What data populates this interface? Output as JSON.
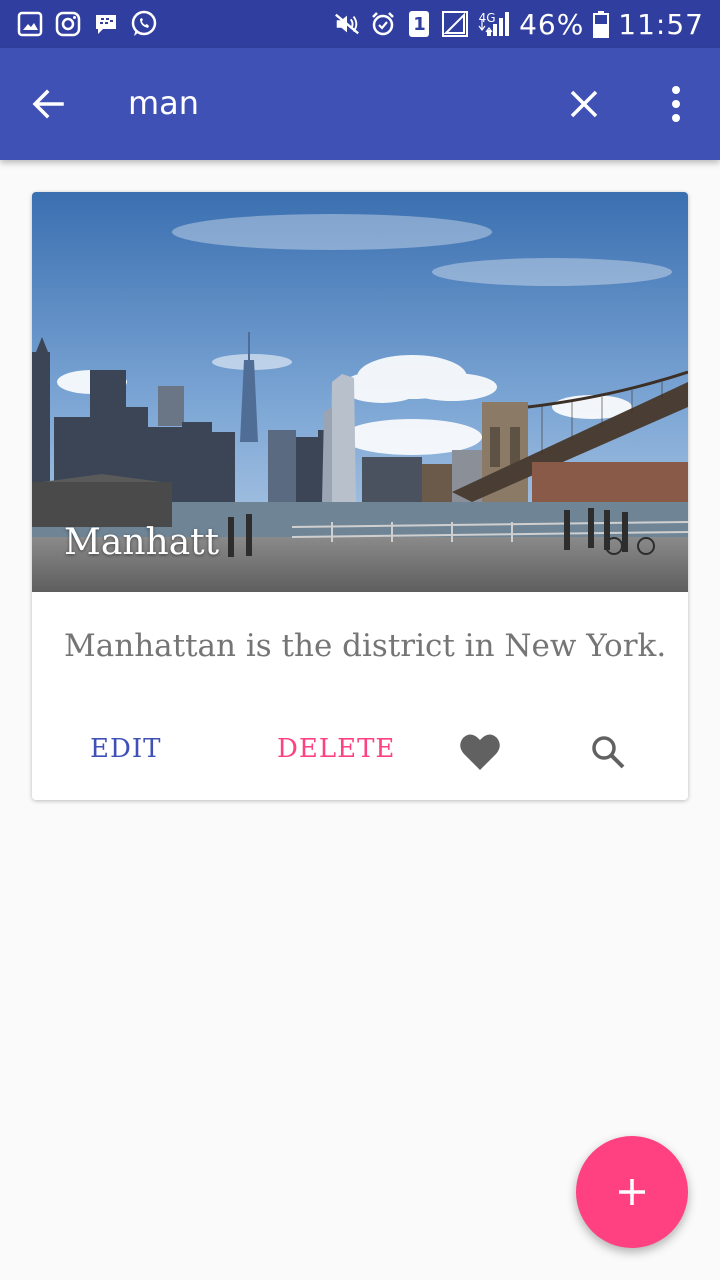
{
  "status_bar": {
    "battery": "46%",
    "time": "11:57",
    "network": "4G",
    "sim": "1",
    "left_icons": [
      "gallery-icon",
      "instagram-icon",
      "bbm-icon",
      "whatsapp-icon"
    ],
    "right_icons": [
      "mute-icon",
      "alarm-icon",
      "sim-icon",
      "signal-icon",
      "battery-icon"
    ]
  },
  "app_bar": {
    "search_query": "man",
    "background": "#3f51b5"
  },
  "card": {
    "title": "Manhatt",
    "description": "Manhattan is the district in New York...",
    "edit_label": "EDIT",
    "delete_label": "DELETE",
    "image_subject": "Manhattan skyline with Brooklyn Bridge"
  },
  "colors": {
    "primary": "#3f51b5",
    "primary_dark": "#303f9f",
    "accent": "#ff4081"
  }
}
